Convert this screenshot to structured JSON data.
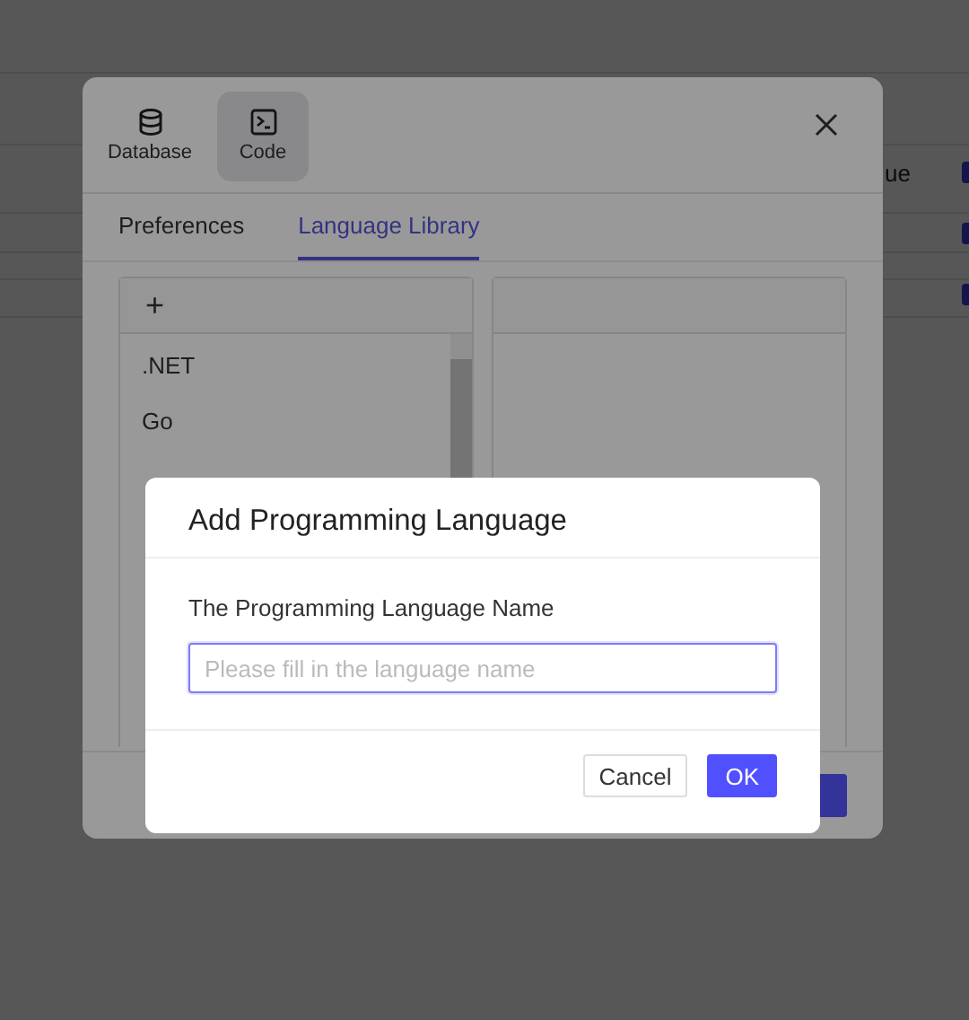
{
  "background": {
    "column_fragment": "ue",
    "checkboxes": [
      {
        "checked": true
      },
      {
        "checked": true
      },
      {
        "checked": true
      }
    ]
  },
  "settings_dialog": {
    "toolbar": [
      {
        "label": "Database",
        "selected": false
      },
      {
        "label": "Code",
        "selected": true
      }
    ],
    "tabs": [
      {
        "label": "Preferences",
        "selected": false
      },
      {
        "label": "Language Library",
        "selected": true
      }
    ],
    "language_list": {
      "add_label": "+",
      "items": [
        ".NET",
        "Go"
      ]
    }
  },
  "add_dialog": {
    "title": "Add Programming Language",
    "field_label": "The Programming Language Name",
    "placeholder": "Please fill in the language name",
    "buttons": [
      {
        "label": "Cancel",
        "kind": "default"
      },
      {
        "label": "OK",
        "kind": "primary"
      }
    ]
  }
}
